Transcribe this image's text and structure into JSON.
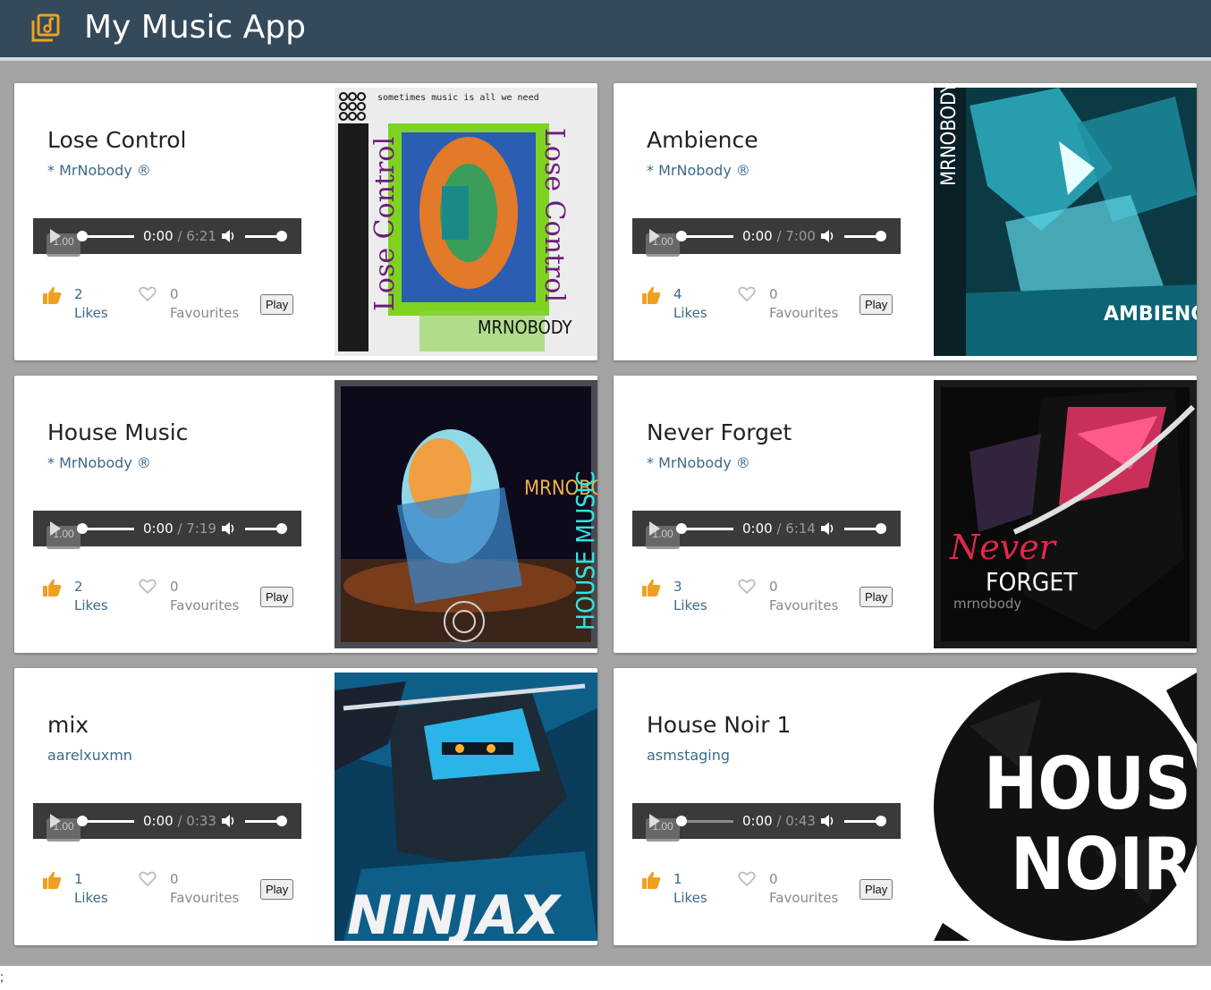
{
  "app": {
    "title": "My Music App",
    "icon": "music-library-icon",
    "accent": "#f0a020",
    "header_bg": "#34495a"
  },
  "cards": [
    {
      "title": "Lose Control",
      "artist": "* MrNobody ®",
      "time_current": "0:00",
      "time_sep": " / ",
      "duration": "6:21",
      "rate": "1.00",
      "likes": "2",
      "likes_label": "Likes",
      "favourites": "0",
      "favourites_label": "Favourites",
      "play_label": "Play",
      "cover_art": "lose-control-cover"
    },
    {
      "title": "Ambience",
      "artist": "* MrNobody ®",
      "time_current": "0:00",
      "time_sep": " / ",
      "duration": "7:00",
      "rate": "1.00",
      "likes": "4",
      "likes_label": "Likes",
      "favourites": "0",
      "favourites_label": "Favourites",
      "play_label": "Play",
      "cover_art": "ambience-cover"
    },
    {
      "title": "House Music",
      "artist": "* MrNobody ®",
      "time_current": "0:00",
      "time_sep": " / ",
      "duration": "7:19",
      "rate": "1.00",
      "likes": "2",
      "likes_label": "Likes",
      "favourites": "0",
      "favourites_label": "Favourites",
      "play_label": "Play",
      "cover_art": "house-music-cover"
    },
    {
      "title": "Never Forget",
      "artist": "* MrNobody ®",
      "time_current": "0:00",
      "time_sep": " / ",
      "duration": "6:14",
      "rate": "1.00",
      "likes": "3",
      "likes_label": "Likes",
      "favourites": "0",
      "favourites_label": "Favourites",
      "play_label": "Play",
      "cover_art": "never-forget-cover"
    },
    {
      "title": "mix",
      "artist": "aarelxuxmn",
      "time_current": "0:00",
      "time_sep": " / ",
      "duration": "0:33",
      "rate": "1.00",
      "likes": "1",
      "likes_label": "Likes",
      "favourites": "0",
      "favourites_label": "Favourites",
      "play_label": "Play",
      "cover_art": "ninjax-cover"
    },
    {
      "title": "House Noir 1",
      "artist": "asmstaging",
      "time_current": "0:00",
      "time_sep": " / ",
      "duration": "0:43",
      "rate": "1.00",
      "likes": "1",
      "likes_label": "Likes",
      "favourites": "0",
      "favourites_label": "Favourites",
      "play_label": "Play",
      "cover_art": "house-noir-cover"
    }
  ],
  "covers": {
    "lose_control": {
      "top": "sometimes music is all we need",
      "left": "Lose Control",
      "right": "Lose Control",
      "bottom": "MRNOBODY"
    },
    "ambience": {
      "left": "MRNOBODY",
      "bottom": "AMBIENCE"
    },
    "house_music": {
      "artist": "MRNOBODY",
      "side": "HOUSE MUSIC"
    },
    "never_forget": {
      "line1": "Never",
      "line2": "FORGET",
      "line3": "mrnobody"
    },
    "ninjax": {
      "text": "NINJAX"
    },
    "house_noir": {
      "line1": "HOUSE",
      "line2": "NOIR"
    }
  },
  "footer": {
    "text": ";"
  }
}
